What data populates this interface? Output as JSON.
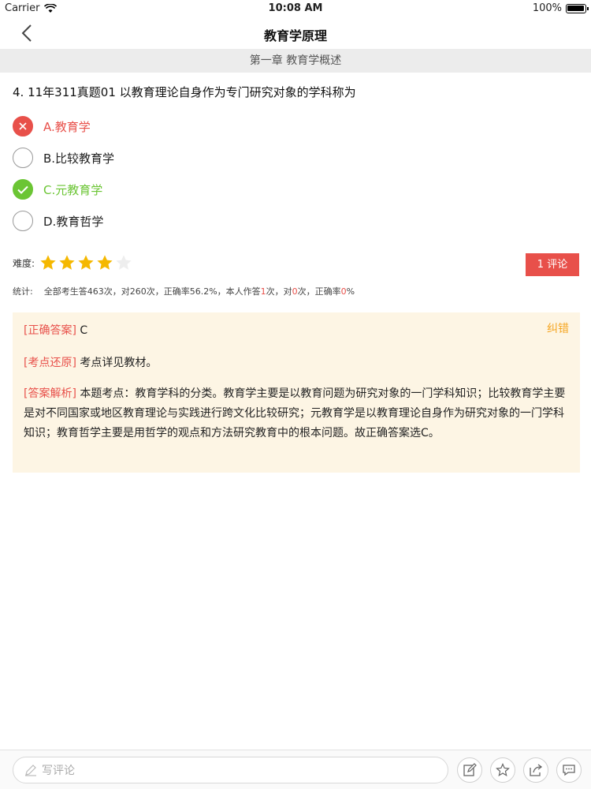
{
  "status": {
    "carrier": "Carrier",
    "time": "10:08 AM",
    "battery": "100%",
    "battery_level": 1.0
  },
  "nav": {
    "title": "教育学原理"
  },
  "chapter": {
    "title": "第一章 教育学概述"
  },
  "question": {
    "text": "4.  11年311真题01 以教育理论自身作为专门研究对象的学科称为"
  },
  "options": [
    {
      "label": "A.教育学",
      "state": "wrong"
    },
    {
      "label": "B.比较教育学",
      "state": "none"
    },
    {
      "label": "C.元教育学",
      "state": "right"
    },
    {
      "label": "D.教育哲学",
      "state": "none"
    }
  ],
  "difficulty": {
    "label": "难度:",
    "rating": 4,
    "max": 5
  },
  "comment_button": "1 评论",
  "stats": {
    "label": "统计:",
    "part1": "全部考生答463次，对260次，正确率56.2%，本人作答",
    "my_count": "1",
    "part2": "次，对",
    "my_right": "0",
    "part3": "次，正确率",
    "my_rate": "0",
    "part4": "%"
  },
  "analysis": {
    "report": "纠错",
    "answer_tag": "[正确答案]",
    "answer": "C",
    "point_tag": "[考点还原]",
    "point": "考点详见教材。",
    "explain_tag": "[答案解析]",
    "explain": "本题考点：教育学科的分类。教育学主要是以教育问题为研究对象的一门学科知识；比较教育学主要是对不同国家或地区教育理论与实践进行跨文化比较研究；元教育学是以教育理论自身作为研究对象的一门学科知识；教育哲学主要是用哲学的观点和方法研究教育中的根本问题。故正确答案选C。"
  },
  "bottom": {
    "placeholder": "写评论"
  },
  "colors": {
    "wrong": "#e8504a",
    "right": "#6bc534",
    "star": "#f5b800",
    "report": "#f5a623"
  },
  "icons": [
    "chevron-left-icon",
    "close-icon",
    "check-icon",
    "star-icon",
    "pencil-icon",
    "edit-icon",
    "favorite-star-icon",
    "share-icon",
    "comment-bubble-icon"
  ]
}
